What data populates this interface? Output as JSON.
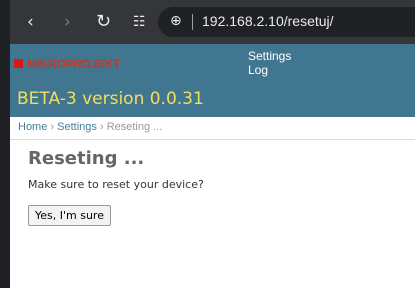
{
  "browser": {
    "url": "192.168.2.10/resetuj/",
    "back_glyph": "‹",
    "forward_glyph": "›",
    "reload_glyph": "↻",
    "apps_glyph": "☷",
    "site_info_glyph": "⊕",
    "icons": [
      "back-icon",
      "forward-icon",
      "reload-icon",
      "apps-icon",
      "site-info-icon"
    ]
  },
  "header": {
    "logo_text": "MIKROPROJEKT",
    "site_title": "BETA-3 version 0.0.31",
    "user_tools": [
      "Settings",
      "Log"
    ],
    "colors": {
      "header_bg": "#417690",
      "title": "#f5dd5d",
      "logo_mark": "#e01515"
    }
  },
  "breadcrumbs": {
    "home": "Home",
    "settings": "Settings",
    "current": "Reseting ...",
    "separator": "›"
  },
  "main": {
    "title": "Reseting ...",
    "message": "Make sure to reset your device?",
    "confirm_button": "Yes, I'm sure"
  }
}
